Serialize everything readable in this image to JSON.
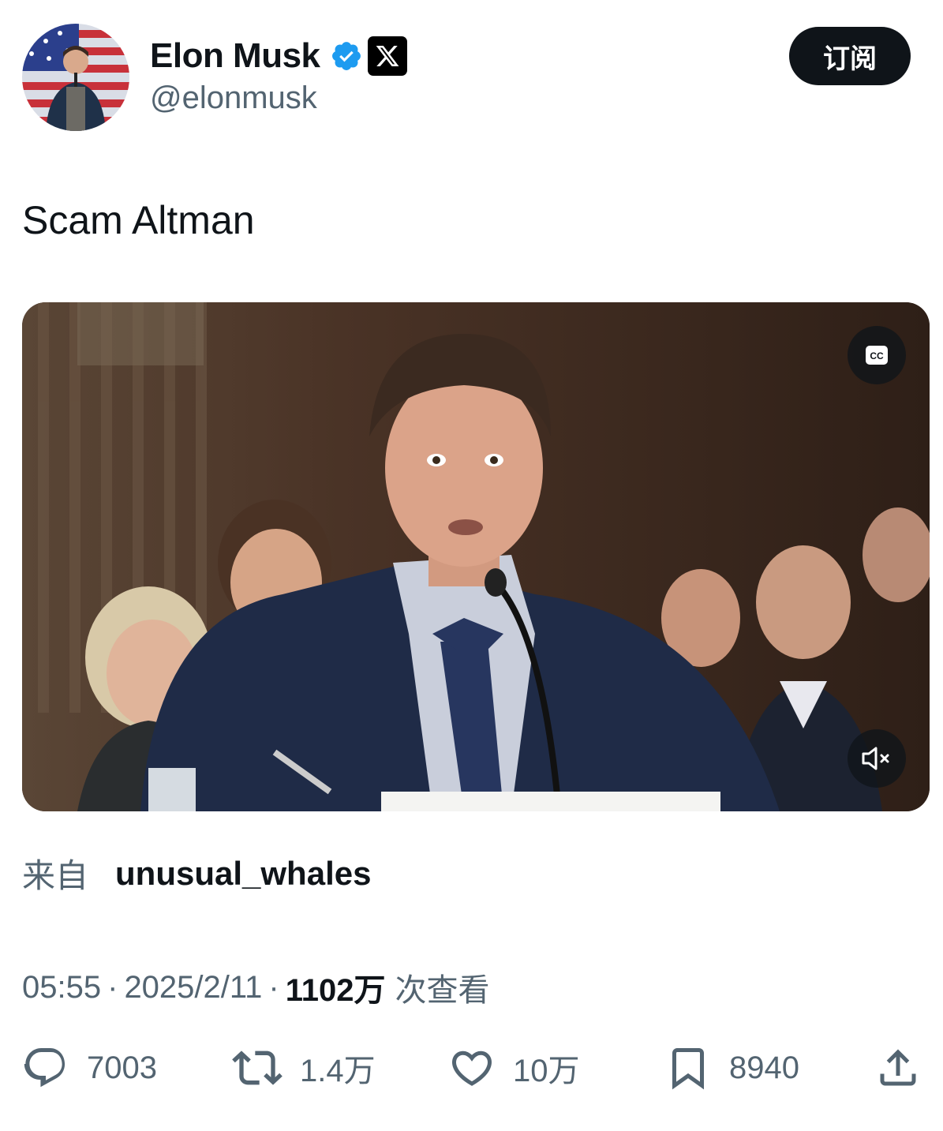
{
  "author": {
    "display_name": "Elon Musk",
    "handle": "@elonmusk",
    "verified_icon": "verified-badge-icon",
    "affiliation_icon": "x-logo-icon",
    "verified_color": "#1d9bf0"
  },
  "header": {
    "subscribe_label": "订阅"
  },
  "tweet": {
    "text": "Scam Altman"
  },
  "media": {
    "cc_label": "CC",
    "cc_icon": "closed-captions-icon",
    "mute_icon": "volume-muted-icon"
  },
  "source": {
    "prefix": "来自",
    "name": "unusual_whales"
  },
  "meta": {
    "time": "05:55",
    "date": "2025/2/11",
    "views_count": "1102万",
    "views_label": "次查看",
    "separator": "·"
  },
  "actions": {
    "replies": "7003",
    "retweets": "1.4万",
    "likes": "10万",
    "bookmarks": "8940"
  },
  "colors": {
    "text_primary": "#0f1419",
    "text_secondary": "#536471",
    "subscribe_bg": "#0f1419"
  }
}
